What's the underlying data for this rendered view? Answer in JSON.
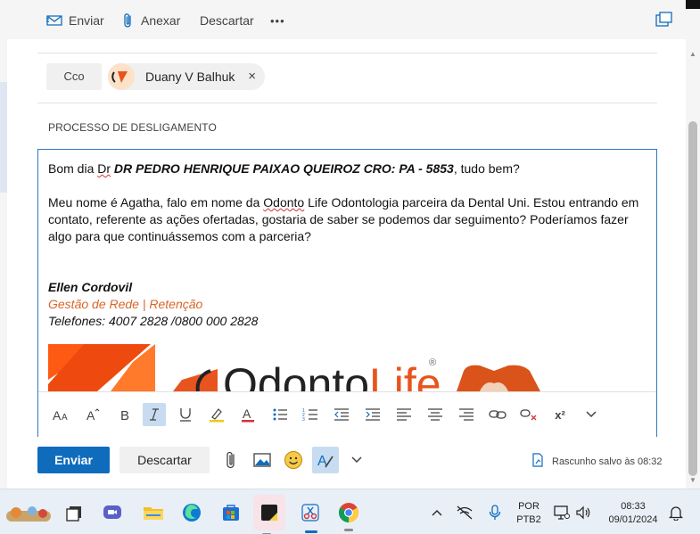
{
  "toolbar": {
    "send_label": "Enviar",
    "attach_label": "Anexar",
    "discard_label": "Descartar",
    "more_label": "•••"
  },
  "recipients": {
    "cco_label": "Cco",
    "contact_name": "Duany V Balhuk",
    "remove_symbol": "×"
  },
  "subject": "PROCESSO DE DESLIGAMENTO",
  "body": {
    "greeting_prefix": "Bom dia ",
    "greeting_dr": "Dr",
    "greeting_bold": " DR PEDRO HENRIQUE PAIXAO QUEIROZ CRO: PA - 5853",
    "greeting_suffix": ", tudo bem?",
    "para_prefix": "Meu nome é Agatha, falo em nome da ",
    "para_odonto": "Odonto",
    "para_rest": " Life Odontologia parceira da Dental Uni. Estou entrando em contato, referente as ações ofertadas, gostaria de saber se podemos dar seguimento? Poderíamos fazer algo para que continuássemos com a parceria?",
    "signature_name": "Ellen Cordovil",
    "signature_role": "Gestão de Rede | Retenção",
    "signature_phones": "Telefones: 4007 2828 /0800 000 2828"
  },
  "banner": {
    "logo_text": "Odonto",
    "logo_text2": "Life",
    "registered": "®"
  },
  "format_bar": {
    "superscript_label": "x²"
  },
  "footer": {
    "send_label": "Enviar",
    "discard_label": "Descartar",
    "draft_status": "Rascunho salvo às 08:32"
  },
  "taskbar": {
    "language_line1": "POR",
    "language_line2": "PTB2",
    "time": "08:33",
    "date": "09/01/2024"
  },
  "colors": {
    "accent_blue": "#0f6cbd",
    "signature_orange": "#d8662a",
    "logo_orange": "#e8541d"
  },
  "icons": {
    "send": "send-icon",
    "attach": "paperclip-icon",
    "popout": "popout-window-icon"
  }
}
